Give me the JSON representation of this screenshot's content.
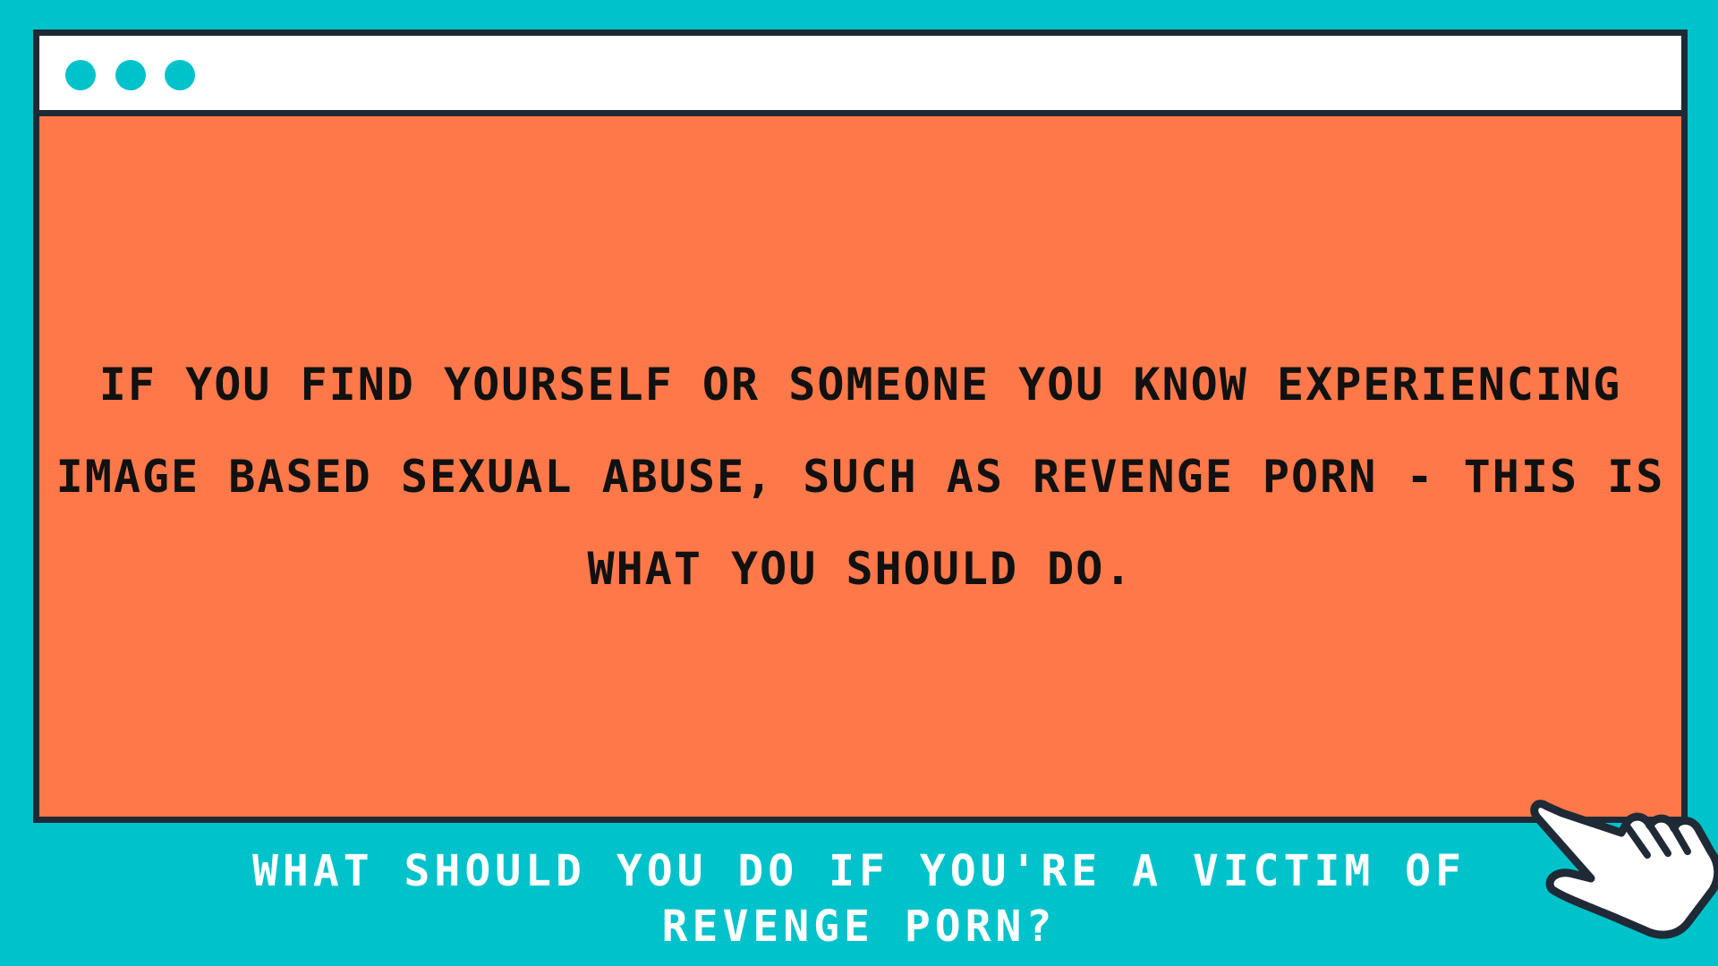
{
  "colors": {
    "background": "#00C2CB",
    "window_body": "#FF7849",
    "titlebar": "#FFFFFF",
    "border": "#1F2A36",
    "dots": "#00C2CB",
    "message_text": "#111111",
    "caption_text": "#FFFFFF"
  },
  "window": {
    "titlebar_dots": [
      "dot",
      "dot",
      "dot"
    ],
    "message": "IF YOU FIND YOURSELF OR SOMEONE YOU KNOW EXPERIENCING IMAGE BASED SEXUAL ABUSE, SUCH AS REVENGE PORN - THIS IS WHAT YOU SHOULD DO."
  },
  "caption": {
    "text": "WHAT SHOULD YOU DO IF YOU'RE A VICTIM OF REVENGE PORN?"
  },
  "cursor": {
    "icon": "pointing-hand-icon"
  }
}
